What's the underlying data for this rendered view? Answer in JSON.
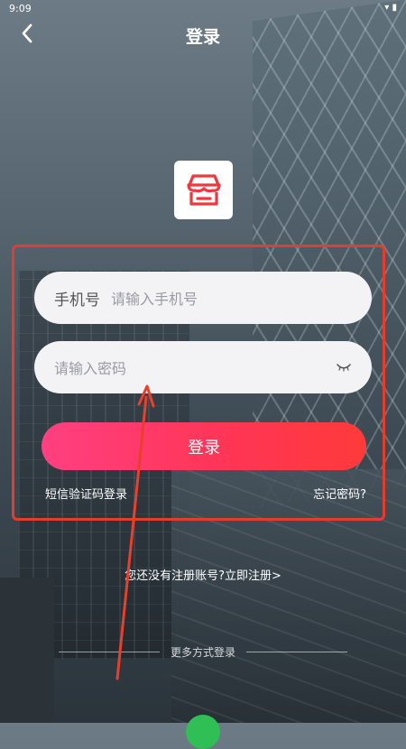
{
  "status_bar": {
    "time": "9:09"
  },
  "header": {
    "title": "登录"
  },
  "form": {
    "phone_label": "手机号",
    "phone_placeholder": "请输入手机号",
    "password_placeholder": "请输入密码",
    "login_button": "登录",
    "sms_login_link": "短信验证码登录",
    "forgot_password_link": "忘记密码?"
  },
  "register_prompt": "您还没有注册账号?立即注册>",
  "more_methods": "更多方式登录",
  "colors": {
    "accent_start": "#ff3f81",
    "accent_end": "#ff3a3a",
    "highlight_box": "#e53c2d",
    "logo_icon": "#f0373f"
  },
  "icons": [
    "back-arrow-icon",
    "store-icon",
    "eye-closed-icon",
    "wifi-icon",
    "battery-icon",
    "wechat-icon"
  ]
}
